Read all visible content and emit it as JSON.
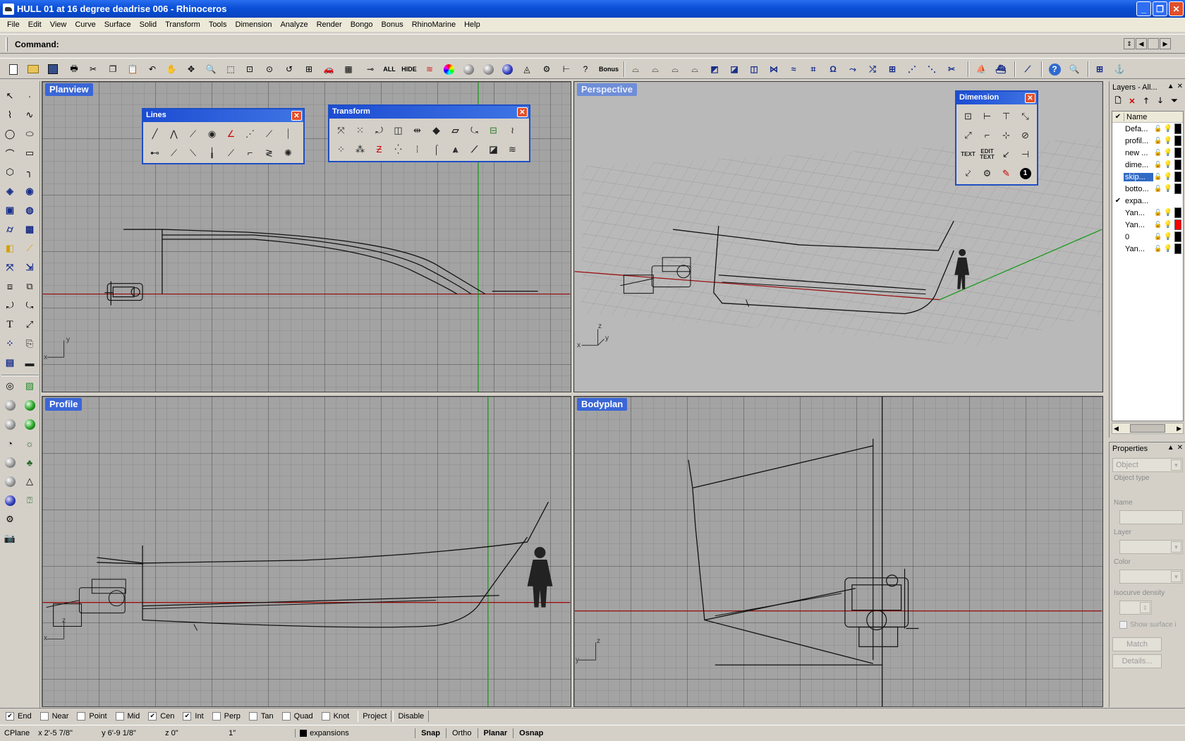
{
  "window": {
    "title": "HULL 01 at 16 degree deadrise 006 - Rhinoceros",
    "controls": [
      "minimize",
      "restore",
      "close"
    ]
  },
  "menu": [
    "File",
    "Edit",
    "View",
    "Curve",
    "Surface",
    "Solid",
    "Transform",
    "Tools",
    "Dimension",
    "Analyze",
    "Render",
    "Bongo",
    "Bonus",
    "RhinoMarine",
    "Help"
  ],
  "command": {
    "label": "Command:",
    "value": ""
  },
  "toolbar": {
    "all_label": "ALL",
    "hide_label": "HIDE",
    "bonus_label": "Bonus"
  },
  "viewports": {
    "plan": {
      "label": "Planview",
      "axis_x": "x",
      "axis_y": "y"
    },
    "perspective": {
      "label": "Perspective",
      "axis_x": "x",
      "axis_y": "y",
      "axis_z": "z"
    },
    "profile": {
      "label": "Profile",
      "axis_x": "x",
      "axis_z": "z"
    },
    "bodyplan": {
      "label": "Bodyplan",
      "axis_y": "y",
      "axis_z": "z"
    }
  },
  "floating_toolbars": {
    "lines": {
      "title": "Lines"
    },
    "transform": {
      "title": "Transform"
    },
    "dimension": {
      "title": "Dimension",
      "text_label": "TEXT",
      "edit_text_label": "EDIT TEXT",
      "badge": "1"
    }
  },
  "layers": {
    "title": "Layers - All...",
    "column_name": "Name",
    "items": [
      {
        "name": "Defa...",
        "checked": false,
        "color": "#000000",
        "selected": false
      },
      {
        "name": "profil...",
        "checked": false,
        "color": "#000000",
        "selected": false
      },
      {
        "name": "new ...",
        "checked": false,
        "color": "#000000",
        "selected": false
      },
      {
        "name": "dime...",
        "checked": false,
        "color": "#000000",
        "selected": false
      },
      {
        "name": "skip...",
        "checked": false,
        "color": "#000000",
        "selected": true
      },
      {
        "name": "botto...",
        "checked": false,
        "color": "#000000",
        "selected": false
      },
      {
        "name": "expa...",
        "checked": true,
        "color": "#000000",
        "selected": false
      },
      {
        "name": "Yan...",
        "checked": false,
        "color": "#000000",
        "selected": false
      },
      {
        "name": "Yan...",
        "checked": false,
        "color": "#ff0000",
        "selected": false
      },
      {
        "name": "0",
        "checked": false,
        "color": "#000000",
        "selected": false
      },
      {
        "name": "Yan...",
        "checked": false,
        "color": "#000000",
        "selected": false
      }
    ]
  },
  "properties": {
    "title": "Properties",
    "select_value": "Object",
    "object_type_label": "Object type",
    "name_label": "Name",
    "layer_label": "Layer",
    "color_label": "Color",
    "isocurve_label": "Isocurve density",
    "show_surface_label": "Show surface i",
    "match_label": "Match",
    "details_label": "Details..."
  },
  "osnap": {
    "items": [
      {
        "label": "End",
        "checked": true
      },
      {
        "label": "Near",
        "checked": false
      },
      {
        "label": "Point",
        "checked": false
      },
      {
        "label": "Mid",
        "checked": false
      },
      {
        "label": "Cen",
        "checked": true
      },
      {
        "label": "Int",
        "checked": true
      },
      {
        "label": "Perp",
        "checked": false
      },
      {
        "label": "Tan",
        "checked": false
      },
      {
        "label": "Quad",
        "checked": false
      },
      {
        "label": "Knot",
        "checked": false
      }
    ],
    "project_label": "Project",
    "disable_label": "Disable"
  },
  "status": {
    "cplane": "CPlane",
    "x": "x 2'-5 7/8\"",
    "y": "y 6'-9 1/8\"",
    "z": "z 0\"",
    "units": "1\"",
    "layer": "expansions",
    "snap": "Snap",
    "ortho": "Ortho",
    "planar": "Planar",
    "osnap": "Osnap"
  }
}
